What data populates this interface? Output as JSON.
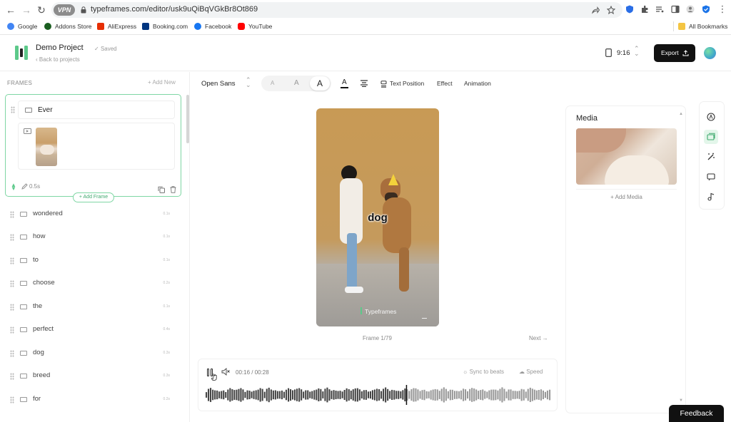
{
  "browser": {
    "url": "typeframes.com/editor/usk9uQiBqVGkBr8Ot869",
    "vpn_label": "VPN",
    "bookmarks": [
      {
        "label": "Google",
        "color": "#4285f4"
      },
      {
        "label": "Addons Store",
        "color": "#1b5e20"
      },
      {
        "label": "AliExpress",
        "color": "#e62e04"
      },
      {
        "label": "Booking.com",
        "color": "#003580"
      },
      {
        "label": "Facebook",
        "color": "#1877f2"
      },
      {
        "label": "YouTube",
        "color": "#ff0000"
      }
    ],
    "all_bookmarks": "All Bookmarks"
  },
  "header": {
    "project_name": "Demo Project",
    "saved": "Saved",
    "back": "Back to projects",
    "ratio": "9:16",
    "export": "Export"
  },
  "frames": {
    "title": "FRAMES",
    "add_new": "+ Add New",
    "selected": {
      "word": "Ever",
      "duration": "0.5s"
    },
    "add_frame": "+ Add Frame",
    "items": [
      {
        "word": "wondered",
        "dur": "0.1s"
      },
      {
        "word": "how",
        "dur": "0.1s"
      },
      {
        "word": "to",
        "dur": "0.1s"
      },
      {
        "word": "choose",
        "dur": "0.2s"
      },
      {
        "word": "the",
        "dur": "0.1s"
      },
      {
        "word": "perfect",
        "dur": "0.4s"
      },
      {
        "word": "dog",
        "dur": "0.3s"
      },
      {
        "word": "breed",
        "dur": "0.3s"
      },
      {
        "word": "for",
        "dur": "0.2s"
      }
    ]
  },
  "toolbar": {
    "font": "Open Sans",
    "size_small": "A",
    "size_medium": "A",
    "size_large": "A",
    "color_icon": "A",
    "text_position": "Text Position",
    "effect": "Effect",
    "animation": "Animation"
  },
  "preview": {
    "caption": "dog",
    "watermark": "Typeframes",
    "frame_counter": "Frame 1/79",
    "next": "Next →"
  },
  "player": {
    "time": "00:16 / 00:28",
    "sync": "Sync to beats",
    "speed": "Speed",
    "progress": 0.58
  },
  "media": {
    "title": "Media",
    "add": "+ Add Media"
  },
  "feedback": "Feedback",
  "colors": {
    "accent": "#5cc98a",
    "dark": "#111111"
  }
}
